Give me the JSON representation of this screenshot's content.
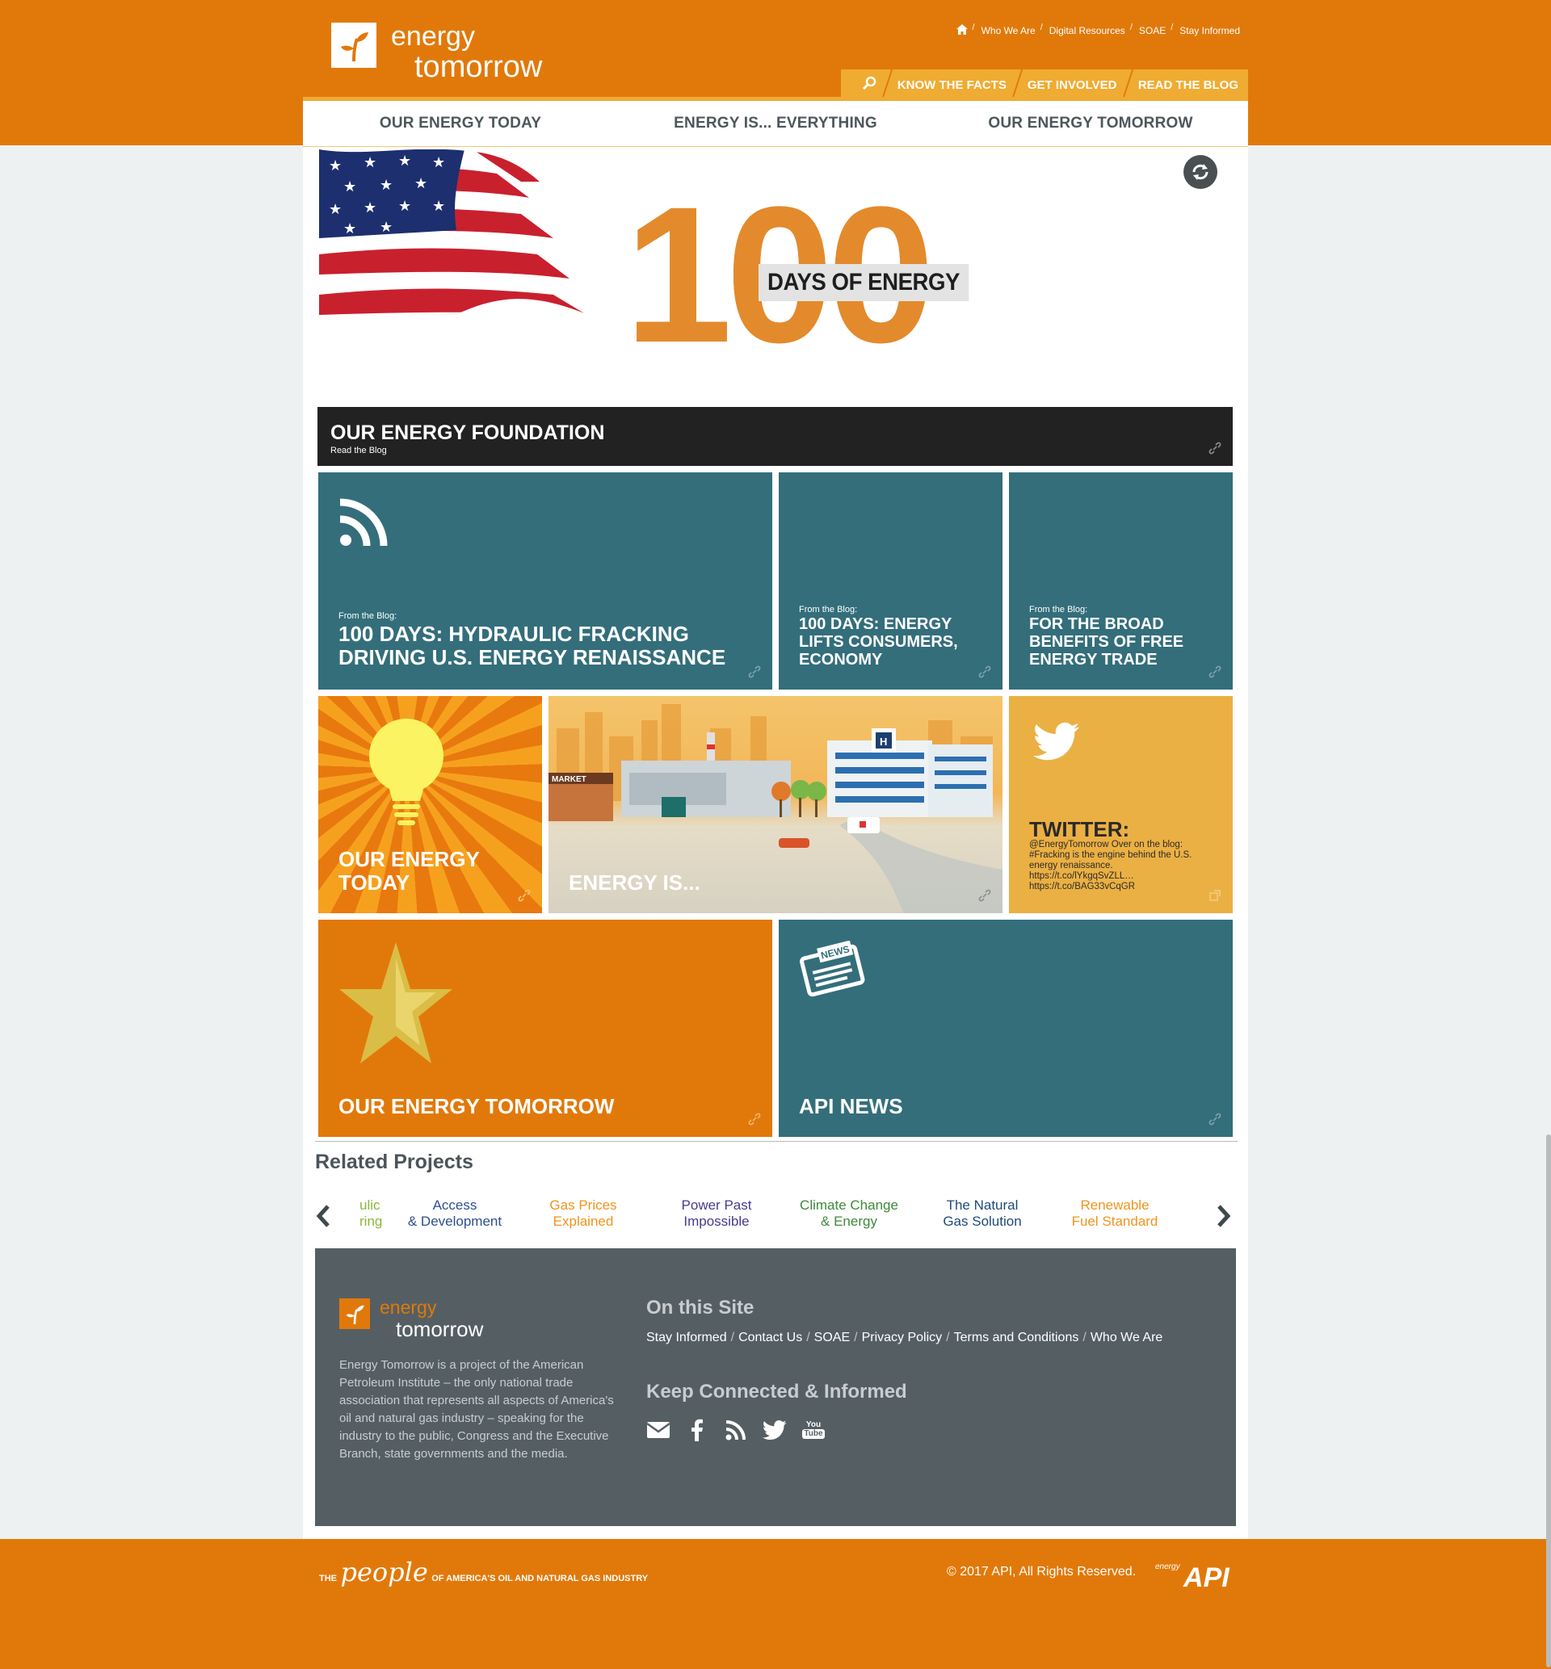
{
  "brand": {
    "line1": "energy",
    "line2": "tomorrow"
  },
  "util_nav": [
    "Who We Are",
    "Digital Resources",
    "SOAE",
    "Stay Informed"
  ],
  "main_nav": [
    "KNOW THE FACTS",
    "GET INVOLVED",
    "READ THE BLOG"
  ],
  "sub_nav": [
    "OUR ENERGY TODAY",
    "ENERGY IS... EVERYTHING",
    "OUR ENERGY TOMORROW"
  ],
  "hero": {
    "number": "100",
    "caption": "DAYS OF ENERGY"
  },
  "foundation": {
    "title": "OUR ENERGY FOUNDATION",
    "subtitle": "Read the Blog"
  },
  "blog_tiles": [
    {
      "label": "From the Blog:",
      "title_l1": "100 DAYS: HYDRAULIC FRACKING",
      "title_l2": "DRIVING U.S. ENERGY RENAISSANCE"
    },
    {
      "label": "From the Blog:",
      "title_l1": "100 DAYS: ENERGY",
      "title_l2": "LIFTS CONSUMERS,",
      "title_l3": "ECONOMY"
    },
    {
      "label": "From the Blog:",
      "title_l1": "FOR THE BROAD",
      "title_l2": "BENEFITS OF FREE",
      "title_l3": "ENERGY TRADE"
    }
  ],
  "tiles": {
    "today_l1": "OUR ENERGY",
    "today_l2": "TODAY",
    "energy_is": "ENERGY IS...",
    "twitter_title": "TWITTER:",
    "tweet_l1": "@EnergyTomorrow Over on the blog:",
    "tweet_l2": "#Fracking is the engine behind the U.S.",
    "tweet_l3": "energy renaissance.",
    "tweet_l4": "https://t.co/lYkgqSvZLL…",
    "tweet_l5": "https://t.co/BAG33vCqGR",
    "market": "MARKET",
    "tomorrow": "OUR ENERGY TOMORROW",
    "news": "API NEWS",
    "news_badge": "NEWS"
  },
  "related": {
    "title": "Related Projects",
    "items": [
      {
        "l1": "ulic",
        "l2": "ring",
        "color": "#8cb63c"
      },
      {
        "l1": "Access",
        "l2": "& Development",
        "color": "#2e4f8e"
      },
      {
        "l1": "Gas Prices",
        "l2": "Explained",
        "color": "#f0931e"
      },
      {
        "l1": "Power Past",
        "l2": "Impossible",
        "color": "#4a3a8c"
      },
      {
        "l1": "Climate Change",
        "l2": "& Energy",
        "color": "#3d8a3a"
      },
      {
        "l1": "The Natural",
        "l2": "Gas Solution",
        "color": "#1f4a7a"
      },
      {
        "l1": "Renewable",
        "l2": "Fuel Standard",
        "color": "#f0931e"
      }
    ]
  },
  "footer": {
    "desc": "Energy Tomorrow is a project of the American Petroleum Institute – the only national trade association that represents all aspects of America's oil and natural gas industry – speaking for the industry to the public, Congress and the Executive Branch, state governments and the media.",
    "site_title": "On this Site",
    "site_links": [
      "Stay Informed",
      "Contact Us",
      "SOAE",
      "Privacy Policy",
      "Terms and Conditions",
      "Who We Are"
    ],
    "connect_title": "Keep Connected & Informed",
    "youtube_l1": "You",
    "youtube_l2": "Tube"
  },
  "bottom": {
    "people_the": "THE",
    "people_word": "people",
    "people_rest": "OF AMERICA'S OIL AND NATURAL GAS INDUSTRY",
    "copyright": "© 2017 API, All Rights Reserved.",
    "api_small": "energy",
    "api_big": "API"
  }
}
